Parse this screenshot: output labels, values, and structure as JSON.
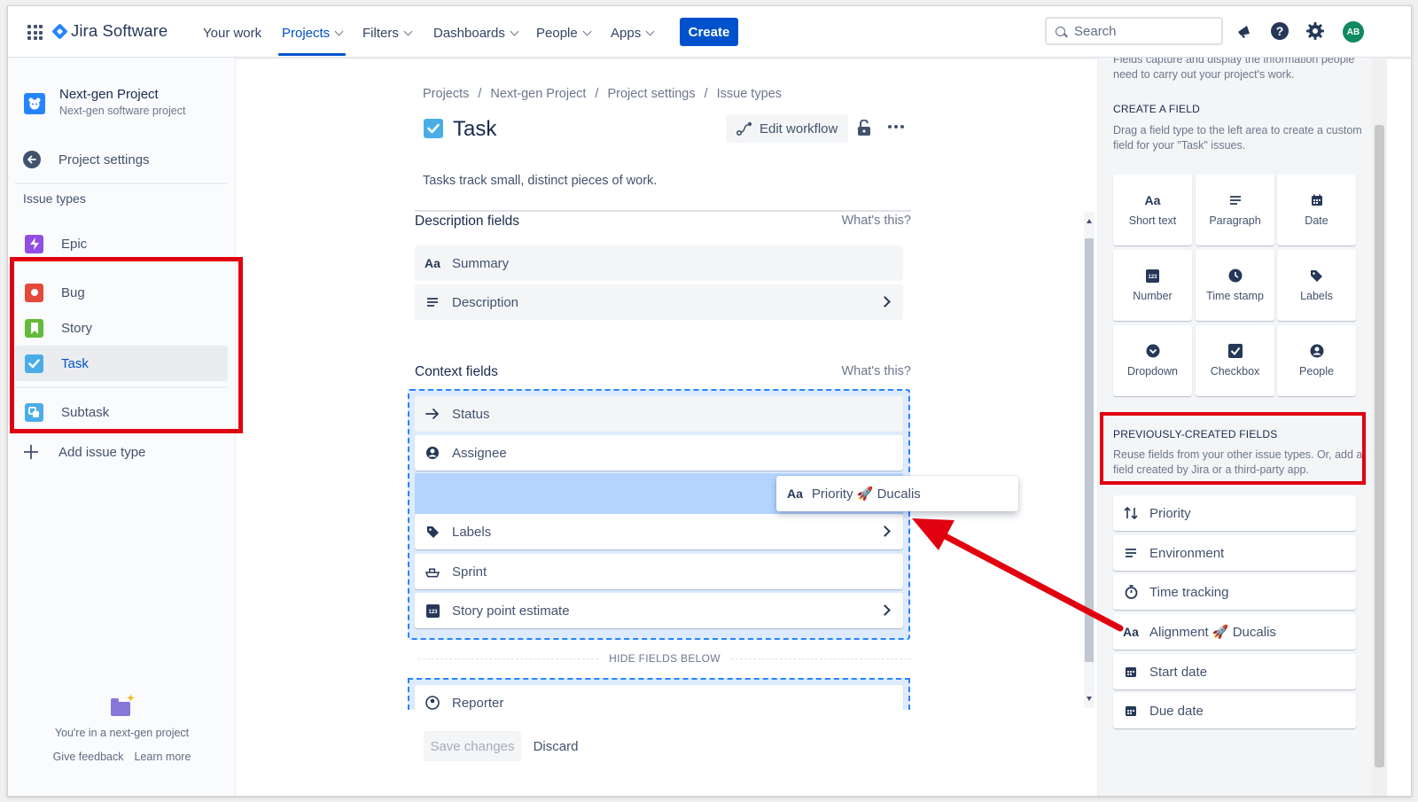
{
  "topnav": {
    "product": "Jira Software",
    "items": [
      {
        "label": "Your work",
        "dropdown": false
      },
      {
        "label": "Projects",
        "dropdown": true,
        "active": true
      },
      {
        "label": "Filters",
        "dropdown": true
      },
      {
        "label": "Dashboards",
        "dropdown": true
      },
      {
        "label": "People",
        "dropdown": true
      },
      {
        "label": "Apps",
        "dropdown": true
      }
    ],
    "create_label": "Create",
    "search_placeholder": "Search",
    "avatar_initials": "AB"
  },
  "sidebar": {
    "project_name": "Next-gen Project",
    "project_subtitle": "Next-gen software project",
    "settings_link": "Project settings",
    "issue_types_heading": "Issue types",
    "issue_types": [
      {
        "label": "Epic",
        "color": "#904ee2"
      },
      {
        "label": "Bug",
        "color": "#e5493a"
      },
      {
        "label": "Story",
        "color": "#63ba3c"
      },
      {
        "label": "Task",
        "color": "#4bade8",
        "selected": true
      },
      {
        "label": "Subtask",
        "color": "#4bade8"
      }
    ],
    "add_issue_type": "Add issue type",
    "footer_text": "You're in a next-gen project",
    "give_feedback": "Give feedback",
    "learn_more": "Learn more"
  },
  "main": {
    "breadcrumbs": [
      "Projects",
      "Next-gen Project",
      "Project settings",
      "Issue types"
    ],
    "title": "Task",
    "edit_workflow": "Edit workflow",
    "description": "Tasks track small, distinct pieces of work.",
    "description_fields": {
      "heading": "Description fields",
      "whats_this": "What's this?",
      "fields": [
        {
          "label": "Summary",
          "icon": "text-aa-icon"
        },
        {
          "label": "Description",
          "icon": "paragraph-icon",
          "chevron": true
        }
      ]
    },
    "context_fields": {
      "heading": "Context fields",
      "whats_this": "What's this?",
      "fields": [
        {
          "label": "Status",
          "icon": "arrow-right-icon"
        },
        {
          "label": "Assignee",
          "icon": "person-icon"
        },
        {
          "label": "Labels",
          "icon": "tag-icon",
          "chevron": true
        },
        {
          "label": "Sprint",
          "icon": "sprint-icon"
        },
        {
          "label": "Story point estimate",
          "icon": "number-icon",
          "chevron": true
        }
      ]
    },
    "dragging_field": {
      "label": "Priority 🚀 Ducalis",
      "icon": "text-aa-icon"
    },
    "hide_fields_below": "HIDE FIELDS BELOW",
    "hidden_fields": [
      {
        "label": "Reporter",
        "icon": "person-icon"
      }
    ],
    "save_changes": "Save changes",
    "discard": "Discard"
  },
  "right_panel": {
    "intro": "Fields capture and display the information people need to carry out your project's work.",
    "create_heading": "CREATE A FIELD",
    "create_text": "Drag a field type to the left area to create a custom field for your \"Task\" issues.",
    "field_types": [
      {
        "label": "Short text",
        "icon": "text-aa-icon"
      },
      {
        "label": "Paragraph",
        "icon": "paragraph-icon"
      },
      {
        "label": "Date",
        "icon": "calendar-icon"
      },
      {
        "label": "Number",
        "icon": "number-icon"
      },
      {
        "label": "Time stamp",
        "icon": "clock-icon"
      },
      {
        "label": "Labels",
        "icon": "tag-icon"
      },
      {
        "label": "Dropdown",
        "icon": "dropdown-icon"
      },
      {
        "label": "Checkbox",
        "icon": "checkbox-icon"
      },
      {
        "label": "People",
        "icon": "person-icon"
      }
    ],
    "previous_heading": "PREVIOUSLY-CREATED FIELDS",
    "previous_text": "Reuse fields from your other issue types. Or, add a field created by Jira or a third-party app.",
    "previous_fields": [
      {
        "label": "Priority",
        "icon": "priority-arrows-icon"
      },
      {
        "label": "Environment",
        "icon": "paragraph-icon"
      },
      {
        "label": "Time tracking",
        "icon": "stopwatch-icon"
      },
      {
        "label": "Alignment 🚀 Ducalis",
        "icon": "text-aa-icon"
      },
      {
        "label": "Start date",
        "icon": "calendar-icon"
      },
      {
        "label": "Due date",
        "icon": "calendar-icon"
      }
    ]
  },
  "colors": {
    "accent": "#0052cc",
    "annotation_red": "#e0000f",
    "drop_zone": "#deebff"
  }
}
